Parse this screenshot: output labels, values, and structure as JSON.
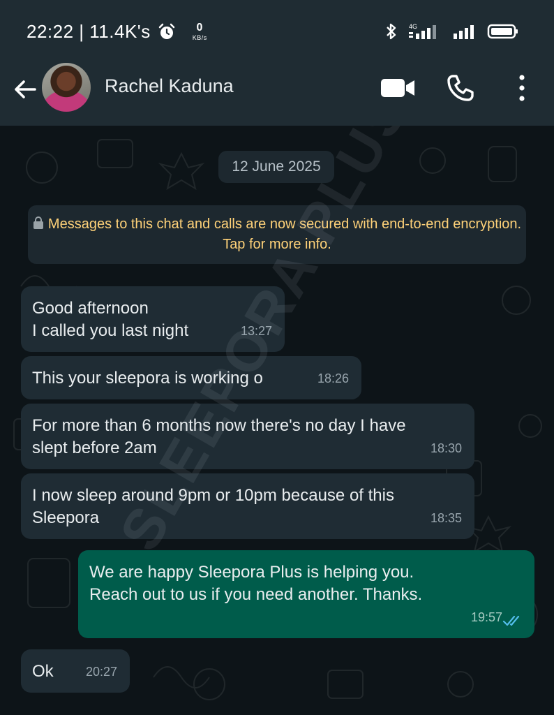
{
  "status_bar": {
    "time_and_speed": "22:22 | 11.4K's",
    "net_speed_value": "0",
    "net_speed_unit": "KB/s",
    "network_label": "4G"
  },
  "header": {
    "contact_name": "Rachel Kaduna"
  },
  "chat": {
    "date_chip": "12 June 2025",
    "encryption_notice": "Messages to this chat and calls are now secured with end-to-end encryption. Tap for more info.",
    "watermark": "SLEEPORA PLUS",
    "messages": [
      {
        "direction": "in",
        "text": "Good afternoon\nI called you last night",
        "time": "13:27"
      },
      {
        "direction": "in",
        "text": "This your sleepora is working o",
        "time": "18:26"
      },
      {
        "direction": "in",
        "text": "For more than 6 months now there's no day I have\nslept before 2am",
        "time": "18:30"
      },
      {
        "direction": "in",
        "text": "I now sleep around 9pm or 10pm because of this\nSleepora",
        "time": "18:35"
      },
      {
        "direction": "out",
        "text": "We are happy Sleepora Plus is helping you.\nReach out to us if you need another. Thanks.",
        "time": "19:57",
        "status": "read"
      },
      {
        "direction": "in",
        "text": "Ok",
        "time": "20:27"
      }
    ]
  },
  "colors": {
    "header_bg": "#1f2c33",
    "chat_bg": "#0d1418",
    "incoming_bubble": "#1f2c34",
    "outgoing_bubble": "#005c4b",
    "notice_text": "#ffd279",
    "read_ticks": "#53bdeb"
  }
}
